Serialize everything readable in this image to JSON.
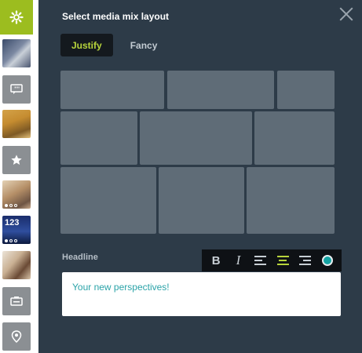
{
  "panel": {
    "title": "Select media mix layout",
    "tabs": [
      {
        "label": "Justify",
        "active": true
      },
      {
        "label": "Fancy",
        "active": false
      }
    ],
    "headline_label": "Headline",
    "editor_text": "Your new perspectives!"
  },
  "rail": {
    "items": [
      {
        "name": "settings",
        "icon": "gear-icon",
        "active": true
      },
      {
        "name": "media-thumb-1",
        "icon": "photo"
      },
      {
        "name": "quote",
        "icon": "quote-bubble-icon"
      },
      {
        "name": "media-thumb-2",
        "icon": "photo"
      },
      {
        "name": "highlight",
        "icon": "star-icon"
      },
      {
        "name": "gallery-1",
        "icon": "photo-gallery"
      },
      {
        "name": "counter",
        "icon": "photo-gallery",
        "text": "123"
      },
      {
        "name": "media-thumb-3",
        "icon": "photo"
      },
      {
        "name": "slideshow",
        "icon": "slideshow-icon"
      },
      {
        "name": "location",
        "icon": "map-pin-icon"
      }
    ]
  },
  "colors": {
    "panel_bg": "#2d3b48",
    "accent": "#9cbd1f",
    "tile": "#5f6c77",
    "text_link": "#2aa3a8",
    "text_color_swatch": "#14a3a3"
  }
}
